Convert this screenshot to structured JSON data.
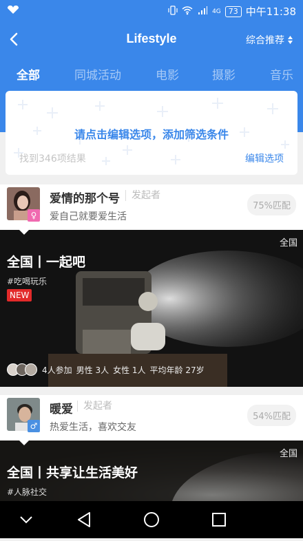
{
  "status": {
    "battery": "73",
    "time": "中午11:38",
    "network": "4G"
  },
  "header": {
    "title": "Lifestyle",
    "sort_label": "综合推荐"
  },
  "tabs": [
    "全部",
    "同城活动",
    "电影",
    "摄影",
    "音乐"
  ],
  "filter": {
    "prompt": "请点击编辑选项，添加筛选条件",
    "result_count": "找到346项结果",
    "edit_label": "编辑选项"
  },
  "items": [
    {
      "organizer": {
        "name": "爱情的那个号",
        "role": "发起者",
        "bio": "爱自己就要爱生活",
        "gender_symbol": "♀",
        "gender_color": "#f06ab0",
        "match": "75%匹配"
      },
      "event": {
        "region": "全国",
        "title": "全国丨一起吧",
        "tag": "#吃喝玩乐",
        "badge": "NEW",
        "stats": {
          "participants": "4人参加",
          "male": "男性 3人",
          "female": "女性 1人",
          "avg_age": "平均年龄 27岁"
        }
      }
    },
    {
      "organizer": {
        "name": "暖爱",
        "role": "发起者",
        "bio": "热爱生活，喜欢交友",
        "gender_symbol": "♂",
        "gender_color": "#4a90e2",
        "match": "54%匹配"
      },
      "event": {
        "region": "全国",
        "title": "全国丨共享让生活美好",
        "tag": "#人脉社交"
      }
    }
  ],
  "colors": {
    "primary": "#3a87ea",
    "new_badge": "#e22a2a"
  },
  "icons": [
    "back-arrow-icon",
    "sort-arrows-icon",
    "nav-back-icon",
    "nav-home-icon",
    "nav-recents-icon",
    "nav-collapse-icon"
  ]
}
